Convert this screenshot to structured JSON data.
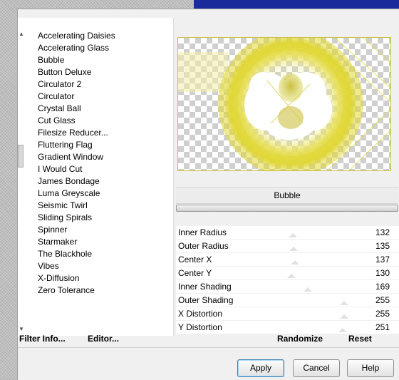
{
  "window": {
    "accent_color": "#1b2a9a"
  },
  "filter_list": {
    "items": [
      "Accelerating Daisies",
      "Accelerating Glass",
      "Bubble",
      "Button Deluxe",
      "Circulator 2",
      "Circulator",
      "Crystal Ball",
      "Cut Glass",
      "Filesize Reducer...",
      "Fluttering Flag",
      "Gradient Window",
      "I Would Cut",
      "James Bondage",
      "Luma Greyscale",
      "Seismic Twirl",
      "Sliding Spirals",
      "Spinner",
      "Starmaker",
      "The Blackhole",
      "Vibes",
      "X-Diffusion",
      "Zero Tolerance"
    ],
    "selected": "Bubble"
  },
  "preview": {
    "filter_name": "Bubble",
    "bubble_color": "#e3dc3a"
  },
  "parameters": [
    {
      "name": "Inner Radius",
      "value": "132",
      "level": 132
    },
    {
      "name": "Outer Radius",
      "value": "135",
      "level": 135
    },
    {
      "name": "Center X",
      "value": "137",
      "level": 137
    },
    {
      "name": "Center Y",
      "value": "130",
      "level": 130
    },
    {
      "name": "Inner Shading",
      "value": "169",
      "level": 169
    },
    {
      "name": "Outer Shading",
      "value": "255",
      "level": 255
    },
    {
      "name": "X Distortion",
      "value": "255",
      "level": 255
    },
    {
      "name": "Y Distortion",
      "value": "251",
      "level": 251
    }
  ],
  "links": {
    "filter_info": "Filter Info...",
    "editor": "Editor...",
    "randomize": "Randomize",
    "reset": "Reset"
  },
  "buttons": {
    "apply": "Apply",
    "cancel": "Cancel",
    "help": "Help"
  }
}
